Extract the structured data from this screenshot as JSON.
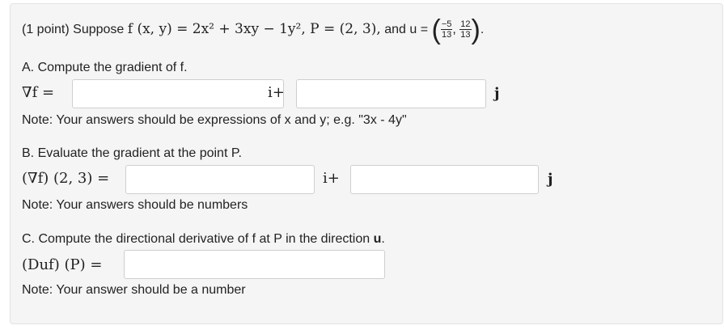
{
  "problem": {
    "points": "(1 point) Suppose",
    "f_eq": "f (x, y) = 2x² + 3xy − 1y², P = (2, 3),",
    "and_u": "and u =",
    "u_x": {
      "num": "−5",
      "den": "13"
    },
    "u_y": {
      "num": "12",
      "den": "13"
    }
  },
  "partA": {
    "prompt": "A. Compute the gradient of f.",
    "label": "∇f =",
    "i_label": "i+",
    "j_label": "j",
    "note": "Note: Your answers should be expressions of x and y; e.g. \"3x - 4y\"",
    "input_i_value": "",
    "input_j_value": ""
  },
  "partB": {
    "prompt": "B. Evaluate the gradient at the point P.",
    "label": "(∇f) (2, 3) =",
    "i_label": "i+",
    "j_label": "j",
    "note": "Note: Your answers should be numbers",
    "input_i_value": "",
    "input_j_value": ""
  },
  "partC": {
    "prompt": "C. Compute the directional derivative of f at P in the direction",
    "u_bold": "u",
    "period": ".",
    "label": "(Duf) (P) =",
    "note": "Note: Your answer should be a number",
    "input_value": ""
  }
}
